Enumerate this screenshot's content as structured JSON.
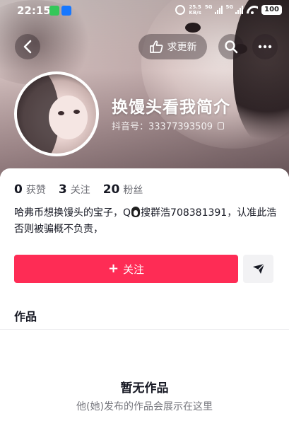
{
  "status_bar": {
    "time": "22:15",
    "net_speed_value": "25.5",
    "net_speed_unit": "KB/s",
    "sim1_label": "5G",
    "sim2_label": "5G",
    "battery": "100"
  },
  "nav": {
    "request_update_label": "求更新"
  },
  "profile": {
    "nickname": "换馒头看我简介",
    "douyin_id": "抖音号：33377393509"
  },
  "stats": [
    {
      "value": "0",
      "label": "获赞"
    },
    {
      "value": "3",
      "label": "关注"
    },
    {
      "value": "20",
      "label": "粉丝"
    }
  ],
  "bio": {
    "text_before_icon": "哈弗币想换馒头的宝子，Q",
    "text_after_icon": "搜群浩708381391，认准此浩否则被骗概不负责，"
  },
  "actions": {
    "follow_label": "关注"
  },
  "tabs": {
    "works_label": "作品"
  },
  "empty_state": {
    "title": "暂无作品",
    "subtitle": "他(她)发布的作品会展示在这里"
  },
  "colors": {
    "accent": "#fe2c55",
    "text_primary": "#161823",
    "text_secondary": "#6d6e75"
  },
  "icons": {
    "back": "chevron-left-icon",
    "request_update": "hand-point-icon",
    "search": "search-icon",
    "more": "more-dots-icon",
    "copy": "copy-icon",
    "qq": "penguin-icon",
    "direct_message": "send-arrow-icon"
  }
}
